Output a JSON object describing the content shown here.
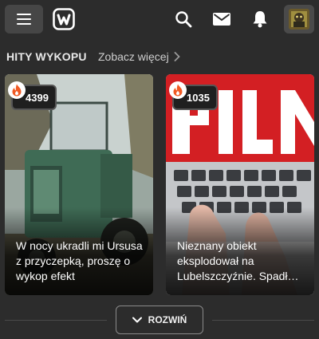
{
  "header": {
    "menu_icon": "hamburger-menu-icon",
    "logo_icon": "wykop-logo-icon",
    "search_icon": "search-icon",
    "mail_icon": "envelope-icon",
    "notifications_icon": "bell-icon",
    "avatar_icon": "user-avatar"
  },
  "section": {
    "title": "HITY WYKOPU",
    "see_more": "Zobacz więcej"
  },
  "cards": [
    {
      "votes": "4399",
      "title": "W nocy ukradli mi Ursusa z przyczepką, proszę o wykop efekt"
    },
    {
      "votes": "1035",
      "title": "Nieznany obiekt eksplodował na Lubelszczyźnie. Spadł…"
    }
  ],
  "expand": {
    "label": "ROZWIŃ"
  },
  "colors": {
    "background": "#2c2c2c",
    "badge_flame": "#f15a24",
    "accent": "#ffffff"
  }
}
